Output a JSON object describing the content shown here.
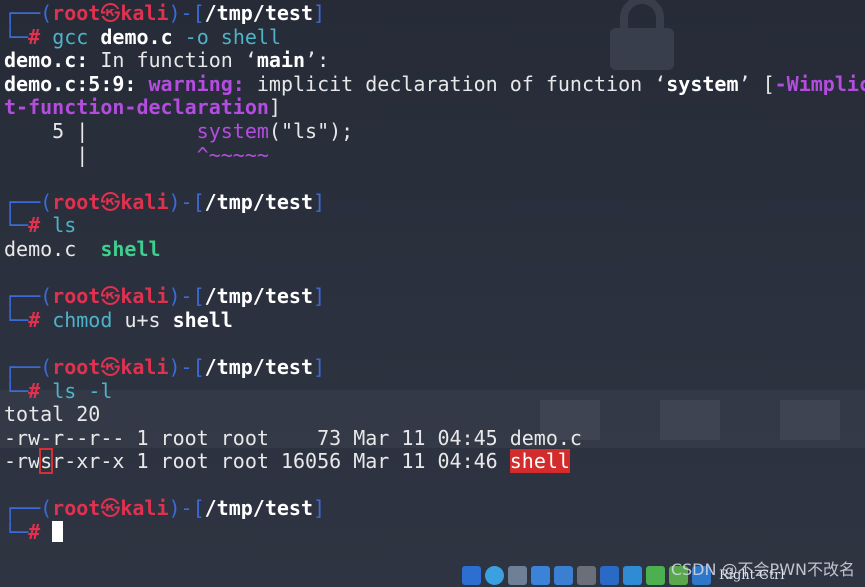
{
  "prompt": {
    "open": "┌──(",
    "user": "root",
    "skull": "㉿",
    "host": "kali",
    "sep": ")-[",
    "path": "/tmp/test",
    "close": "]",
    "lower": "└─",
    "hash": "#"
  },
  "block1": {
    "cmd": "gcc",
    "arg1": "demo.c",
    "arg2": "-o",
    "arg3": "shell",
    "l1_file": "demo.c:",
    "l1_text": " In function ‘",
    "l1_fn": "main",
    "l1_end": "’:",
    "l2_loc": "demo.c:5:9:",
    "l2_warn": " warning:",
    "l2_text": " implicit declaration of function ‘",
    "l2_fn": "system",
    "l2_mid": "’ [",
    "l2_flag": "-Wimplici",
    "l3_flag": "t-function-declaration",
    "l3_end": "]",
    "l4_num": "    5 |         ",
    "l4_code_fn": "system",
    "l4_code_rest": "(\"ls\");",
    "l5_bar": "      |         ",
    "l5_caret": "^~~~~~"
  },
  "block2": {
    "cmd": "ls",
    "out_plain": "demo.c  ",
    "out_exec": "shell"
  },
  "block3": {
    "cmd": "chmod",
    "arg1": "u+s",
    "arg2": "shell"
  },
  "block4": {
    "cmd": "ls",
    "arg": "-l",
    "total": "total 20",
    "row1": "-rw-r--r-- 1 root root    73 Mar 11 04:45 demo.c",
    "row2_pre": "-rw",
    "row2_s": "s",
    "row2_mid": "r-xr-x 1 root root 16056 Mar 11 04:46 ",
    "row2_file": "shell"
  },
  "taskbar": {
    "right_ctrl": "Right Ctrl"
  },
  "watermark": "CSDN @不会PWN不改名",
  "colors": {
    "accent_red": "#e0314f",
    "frame_blue": "#3d6bd6",
    "warn_purple": "#b44ce0",
    "exec_green": "#3ecf8e"
  }
}
